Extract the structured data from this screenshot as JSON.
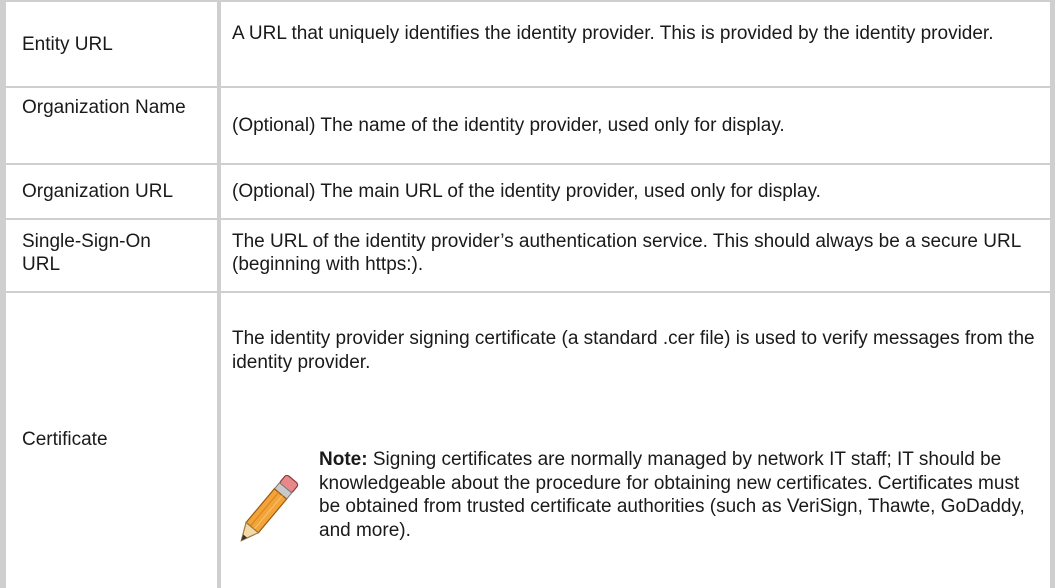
{
  "table": {
    "rows": [
      {
        "term": "Entity URL",
        "description": "A URL that uniquely identifies the identity provider. This is provided by the identity provider."
      },
      {
        "term": "Organization Name",
        "description": "(Optional) The name of the identity provider, used only for display."
      },
      {
        "term": "Organization URL",
        "description": "(Optional) The main URL of the identity provider, used only for display."
      },
      {
        "term": "Single-Sign-On URL",
        "description": "The URL of the identity provider’s authentication service. This should always be a secure URL (beginning with https:)."
      },
      {
        "term": "Certificate",
        "description": "The identity provider signing certificate (a standard .cer file) is used to verify messages from the identity provider."
      }
    ],
    "note": {
      "label": "Note:",
      "text": "Signing certificates are normally managed by network IT staff; IT should be knowledgeable about the procedure for obtaining new certificates. Certificates must be obtained from trusted certificate authorities (such as VeriSign, Thawte, GoDaddy, and more).",
      "icon": "pencil-icon"
    }
  }
}
